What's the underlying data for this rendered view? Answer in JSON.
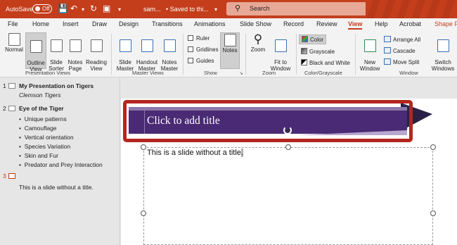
{
  "titlebar": {
    "autosave_label": "AutoSave",
    "autosave_state": "Off",
    "filename": "sam...",
    "saved_status": "• Saved to thi...",
    "search_placeholder": "Search"
  },
  "tabs": [
    {
      "label": "File"
    },
    {
      "label": "Home"
    },
    {
      "label": "Insert"
    },
    {
      "label": "Draw"
    },
    {
      "label": "Design"
    },
    {
      "label": "Transitions"
    },
    {
      "label": "Animations"
    },
    {
      "label": "Slide Show"
    },
    {
      "label": "Record"
    },
    {
      "label": "Review"
    },
    {
      "label": "View"
    },
    {
      "label": "Help"
    },
    {
      "label": "Acrobat"
    },
    {
      "label": "Shape F"
    }
  ],
  "ribbon": {
    "presentation_views": {
      "label": "Presentation Views",
      "buttons": [
        {
          "label": "Normal"
        },
        {
          "label": "Outline\nView"
        },
        {
          "label": "Slide\nSorter"
        },
        {
          "label": "Notes\nPage"
        },
        {
          "label": "Reading\nView"
        }
      ]
    },
    "master_views": {
      "label": "Master Views",
      "buttons": [
        {
          "label": "Slide\nMaster"
        },
        {
          "label": "Handout\nMaster"
        },
        {
          "label": "Notes\nMaster"
        }
      ]
    },
    "show": {
      "label": "Show",
      "checks": [
        {
          "label": "Ruler"
        },
        {
          "label": "Gridlines"
        },
        {
          "label": "Guides"
        }
      ],
      "notes_label": "Notes"
    },
    "zoom": {
      "label": "Zoom",
      "zoom_label": "Zoom",
      "fit_label": "Fit to\nWindow"
    },
    "color": {
      "label": "Color/Grayscale",
      "options": [
        {
          "label": "Color"
        },
        {
          "label": "Grayscale"
        },
        {
          "label": "Black and White"
        }
      ]
    },
    "window": {
      "label": "Window",
      "new_window_label": "New\nWindow",
      "items": [
        {
          "label": "Arrange All"
        },
        {
          "label": "Cascade"
        },
        {
          "label": "Move Split"
        }
      ],
      "switch_label": "Switch\nWindows"
    }
  },
  "outline": {
    "slides": [
      {
        "num": "1",
        "title": "My Presentation on Tigers",
        "subtitle": "Clemson Tigers"
      },
      {
        "num": "2",
        "title": "Eye of the Tiger",
        "bullets": [
          "Unique patterns",
          "Camouflage",
          "Vertical orientation",
          "Species Variation",
          "Skin and Fur",
          "Predator and Prey Interaction"
        ]
      },
      {
        "num": "3",
        "text": "This is a slide without a title."
      }
    ]
  },
  "slide": {
    "title_placeholder": "Click to add title",
    "body_text": "This is a slide without a title",
    "body_sel_char": "."
  }
}
